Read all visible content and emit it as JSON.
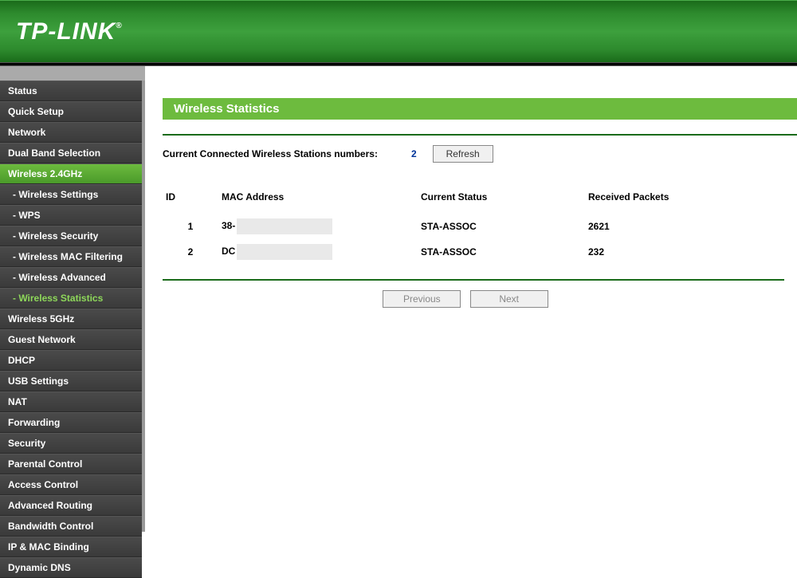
{
  "brand": "TP-LINK",
  "sidebar": {
    "items": [
      {
        "label": "Status",
        "type": "main"
      },
      {
        "label": "Quick Setup",
        "type": "main"
      },
      {
        "label": "Network",
        "type": "main"
      },
      {
        "label": "Dual Band Selection",
        "type": "main"
      },
      {
        "label": "Wireless 2.4GHz",
        "type": "main",
        "active": true
      },
      {
        "label": "- Wireless Settings",
        "type": "sub"
      },
      {
        "label": "- WPS",
        "type": "sub"
      },
      {
        "label": "- Wireless Security",
        "type": "sub"
      },
      {
        "label": "- Wireless MAC Filtering",
        "type": "sub"
      },
      {
        "label": "- Wireless Advanced",
        "type": "sub"
      },
      {
        "label": "- Wireless Statistics",
        "type": "sub",
        "current": true
      },
      {
        "label": "Wireless 5GHz",
        "type": "main"
      },
      {
        "label": "Guest Network",
        "type": "main"
      },
      {
        "label": "DHCP",
        "type": "main"
      },
      {
        "label": "USB Settings",
        "type": "main"
      },
      {
        "label": "NAT",
        "type": "main"
      },
      {
        "label": "Forwarding",
        "type": "main"
      },
      {
        "label": "Security",
        "type": "main"
      },
      {
        "label": "Parental Control",
        "type": "main"
      },
      {
        "label": "Access Control",
        "type": "main"
      },
      {
        "label": "Advanced Routing",
        "type": "main"
      },
      {
        "label": "Bandwidth Control",
        "type": "main"
      },
      {
        "label": "IP & MAC Binding",
        "type": "main"
      },
      {
        "label": "Dynamic DNS",
        "type": "main"
      }
    ]
  },
  "page": {
    "title": "Wireless Statistics",
    "stats_label": "Current Connected Wireless Stations numbers:",
    "stats_count": "2",
    "refresh_label": "Refresh",
    "headers": {
      "id": "ID",
      "mac": "MAC Address",
      "status": "Current Status",
      "packets": "Received Packets"
    },
    "rows": [
      {
        "id": "1",
        "mac_prefix": "38-",
        "status": "STA-ASSOC",
        "packets": "2621"
      },
      {
        "id": "2",
        "mac_prefix": "DC",
        "status": "STA-ASSOC",
        "packets": "232"
      }
    ],
    "prev_label": "Previous",
    "next_label": "Next"
  }
}
